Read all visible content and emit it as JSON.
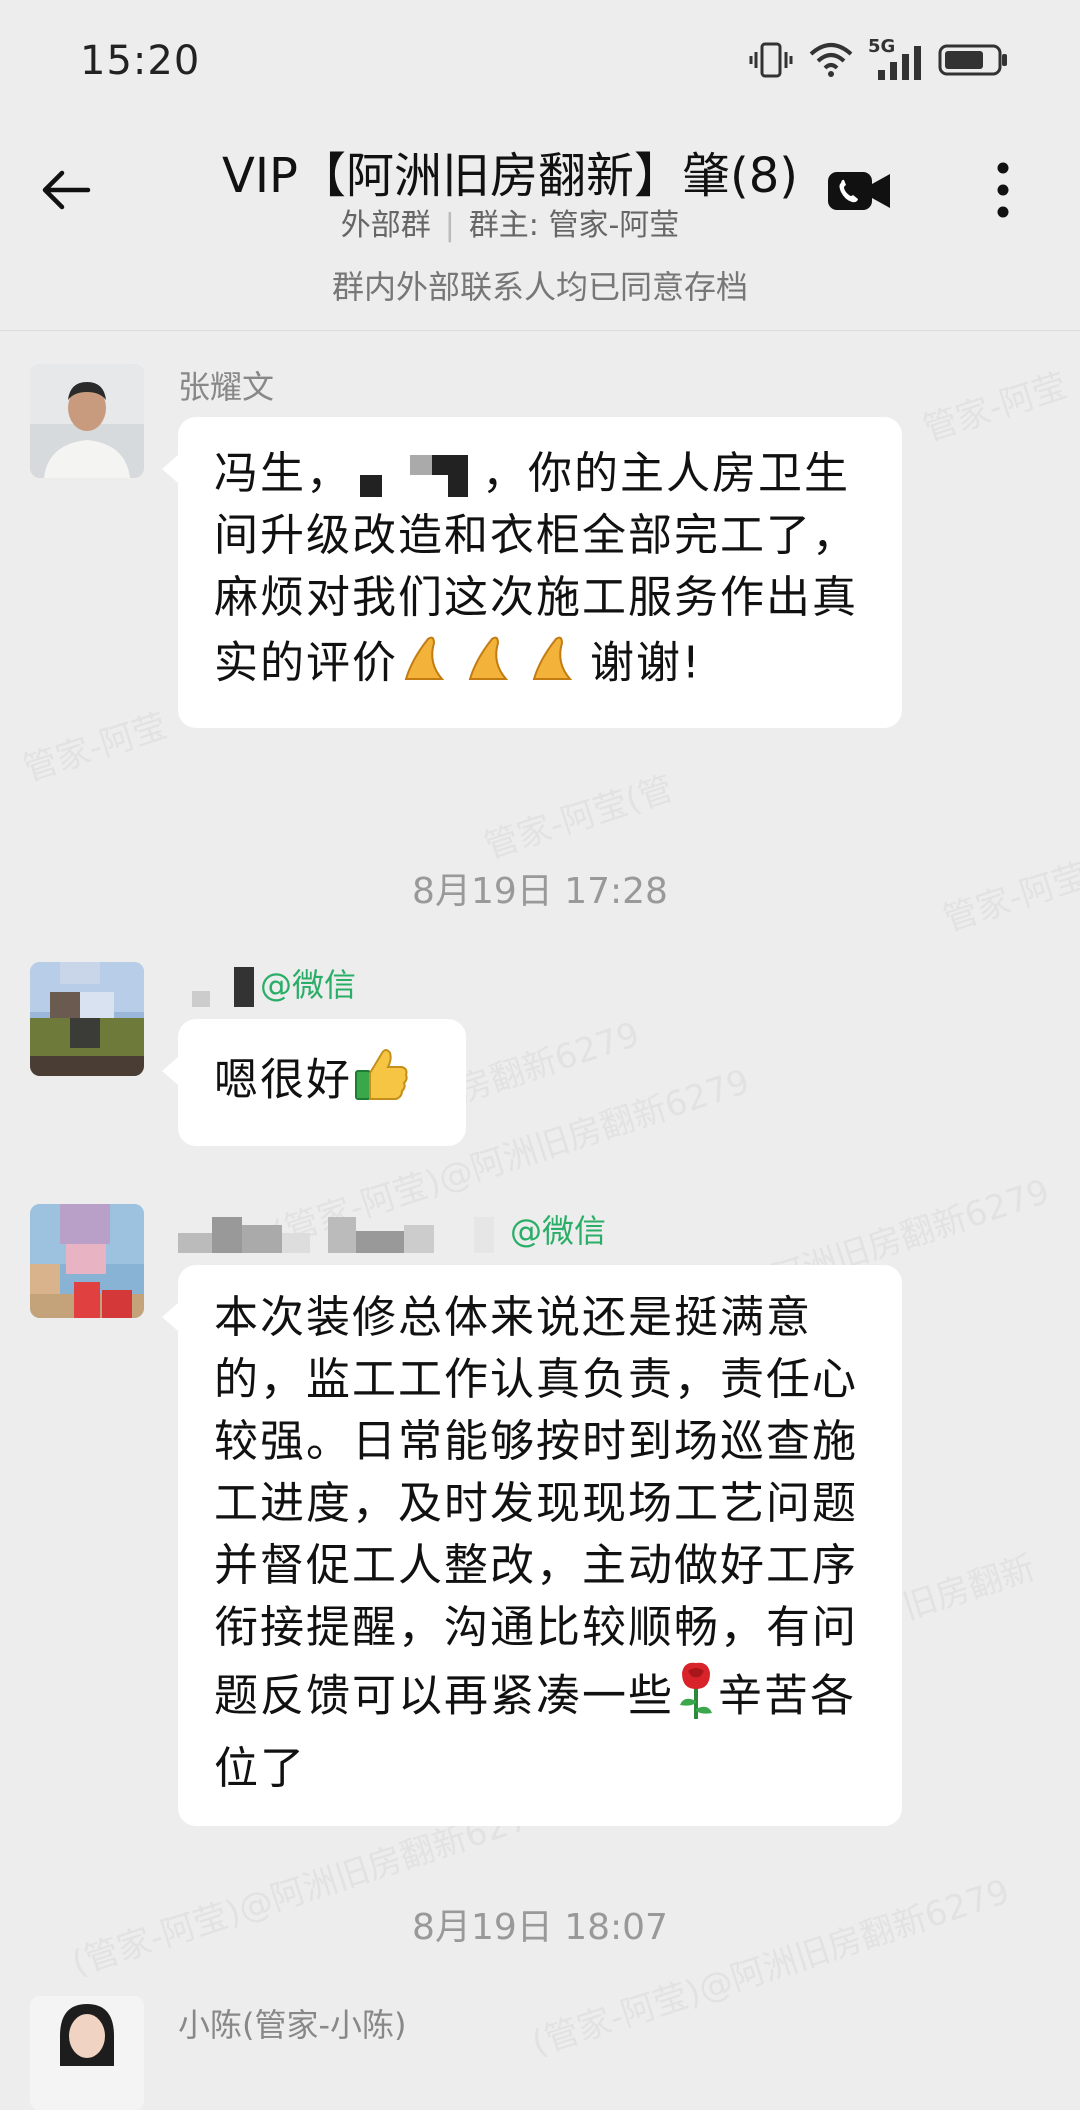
{
  "status_bar": {
    "time": "15:20",
    "network": "5G"
  },
  "header": {
    "title": "VIP【阿洲旧房翻新】肇(8)",
    "group_type": "外部群",
    "owner": "群主: 管家-阿莹"
  },
  "notice": "群内外部联系人均已同意存档",
  "watermark": "(管家-阿莹)@阿洲旧房翻新6279",
  "messages": [
    {
      "sender": "张耀文",
      "text_part1": "冯生，",
      "text_part2": "，你的主人房卫生间升级改造和衣柜全部完工了，麻烦对我们这次施工服务作出真实的评价",
      "text_part3": "谢谢!"
    },
    {
      "timestamp": "8月19日  17:28"
    },
    {
      "sender_suffix": "@微信",
      "text": "嗯很好"
    },
    {
      "sender_suffix": "@微信",
      "text_part1": "本次装修总体来说还是挺满意的，监工工作认真负责，责任心较强。日常能够按时到场巡查施工进度，及时发现现场工艺问题并督促工人整改，主动做好工序衔接提醒，沟通比较顺畅，有问题反馈可以再紧凑一些",
      "text_part2": "辛苦各位了"
    },
    {
      "timestamp": "8月19日  18:07"
    },
    {
      "sender": "小陈(管家-小陈)"
    }
  ]
}
